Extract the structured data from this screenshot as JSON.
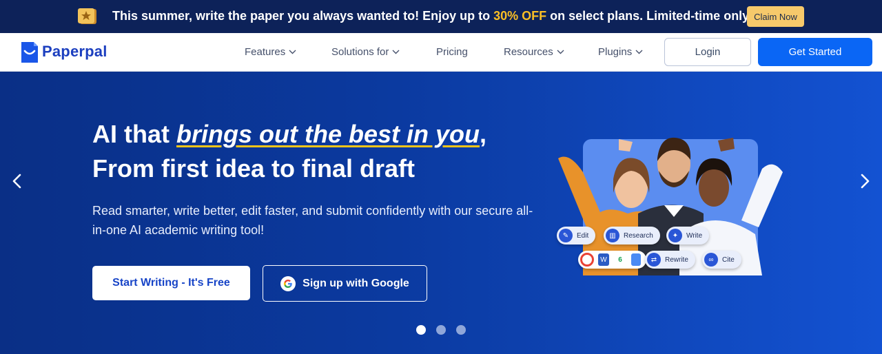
{
  "promo": {
    "text_before": "This summer, write the paper you always wanted to! Enjoy up to ",
    "highlight": "30% OFF",
    "text_after": " on select plans. Limited-time only!",
    "claim_label": "Claim Now"
  },
  "nav": {
    "logo_text": "Paperpal",
    "items": [
      {
        "label": "Features",
        "has_dropdown": true
      },
      {
        "label": "Solutions for",
        "has_dropdown": true
      },
      {
        "label": "Pricing",
        "has_dropdown": false
      },
      {
        "label": "Resources",
        "has_dropdown": true
      },
      {
        "label": "Plugins",
        "has_dropdown": true
      }
    ],
    "login_label": "Login",
    "get_started_label": "Get Started"
  },
  "hero": {
    "headline_prefix": "AI that ",
    "headline_emphasis": "brings out the best in you",
    "headline_suffix": ",",
    "headline_line2": "From first idea to final draft",
    "subtitle": "Read smarter, write better, edit faster, and submit confidently with our secure all-in-one AI academic writing tool!",
    "start_label": "Start Writing - It's Free",
    "google_label": "Sign up with Google",
    "chips": {
      "edit": "Edit",
      "research": "Research",
      "write": "Write",
      "rewrite": "Rewrite",
      "cite": "Cite"
    },
    "carousel_slides": 3,
    "carousel_active": 1
  },
  "colors": {
    "promo_bg": "#0d2259",
    "highlight": "#fbbf24",
    "primary": "#0a66f5",
    "hero_bg": "#0b3aa0",
    "underline": "#f5c518"
  }
}
